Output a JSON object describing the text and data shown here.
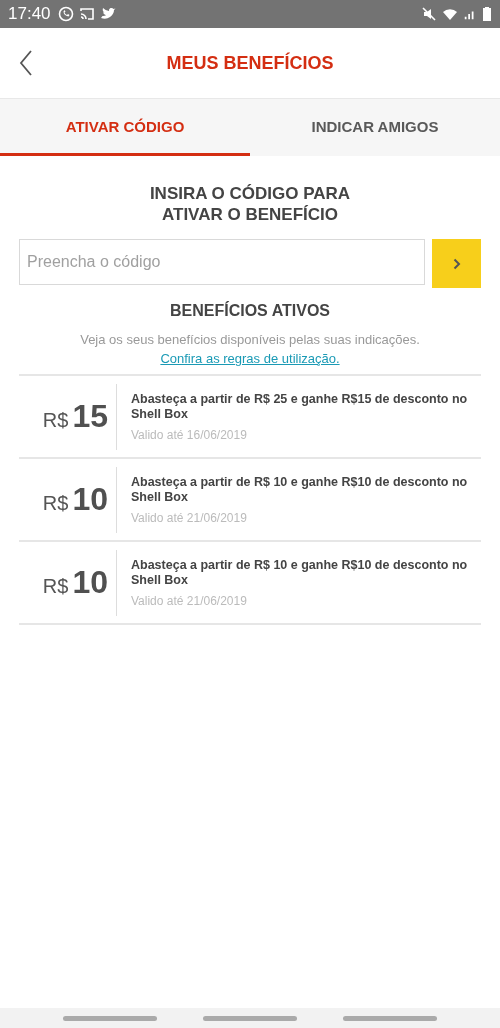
{
  "status_bar": {
    "time": "17:40"
  },
  "header": {
    "title": "MEUS BENEFÍCIOS"
  },
  "tabs": [
    {
      "label": "ATIVAR CÓDIGO",
      "selected": true
    },
    {
      "label": "INDICAR AMIGOS",
      "selected": false
    }
  ],
  "code_section": {
    "heading": "INSIRA O CÓDIGO PARA ATIVAR O BENEFÍCIO",
    "placeholder": "Preencha o código"
  },
  "benefits_section": {
    "heading": "BENEFÍCIOS ATIVOS",
    "description": "Veja os seus benefícios disponíveis pelas suas indicações.",
    "link": "Confira as regras de utilização."
  },
  "benefits": [
    {
      "currency": "R$",
      "amount": "15",
      "description": "Abasteça a partir de R$ 25 e ganhe R$15 de desconto no Shell Box",
      "validity": "Valido até 16/06/2019"
    },
    {
      "currency": "R$",
      "amount": "10",
      "description": "Abasteça a partir de R$ 10 e ganhe R$10 de desconto no Shell Box",
      "validity": "Valido até 21/06/2019"
    },
    {
      "currency": "R$",
      "amount": "10",
      "description": "Abasteça a partir de R$ 10 e ganhe R$10 de desconto no Shell Box",
      "validity": "Valido até 21/06/2019"
    }
  ]
}
